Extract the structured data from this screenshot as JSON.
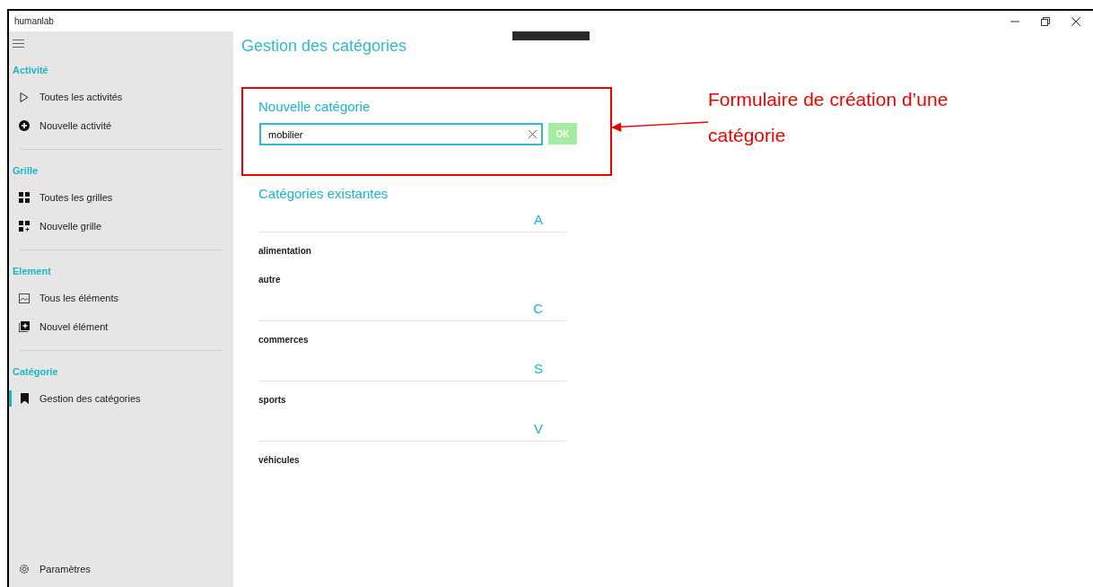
{
  "window": {
    "title": "humanlab"
  },
  "sidebar": {
    "sections": [
      {
        "title": "Activité",
        "items": [
          {
            "label": "Toutes les activités",
            "kind": "list",
            "selected": false
          },
          {
            "label": "Nouvelle activité",
            "kind": "create",
            "selected": false
          }
        ]
      },
      {
        "title": "Grille",
        "items": [
          {
            "label": "Toutes les grilles",
            "kind": "list",
            "selected": false
          },
          {
            "label": "Nouvelle grille",
            "kind": "create",
            "selected": false
          }
        ]
      },
      {
        "title": "Element",
        "items": [
          {
            "label": "Tous les éléments",
            "kind": "list",
            "selected": false
          },
          {
            "label": "Nouvel élément",
            "kind": "create",
            "selected": false
          }
        ]
      },
      {
        "title": "Catégorie",
        "items": [
          {
            "label": "Gestion des catégories",
            "kind": "manage",
            "selected": true
          }
        ]
      }
    ],
    "footer": {
      "label": "Paramètres"
    }
  },
  "page": {
    "title": "Gestion des catégories",
    "new_category": {
      "heading": "Nouvelle catégorie",
      "value": "mobilier",
      "button": "OK",
      "button_disabled": true
    },
    "existing": {
      "heading": "Catégories existantes",
      "groups": [
        {
          "letter": "A",
          "items": [
            "alimentation",
            "autre"
          ]
        },
        {
          "letter": "C",
          "items": [
            "commerces"
          ]
        },
        {
          "letter": "S",
          "items": [
            "sports"
          ]
        },
        {
          "letter": "V",
          "items": [
            "véhicules"
          ]
        }
      ]
    }
  },
  "annotation": {
    "text": "Formulaire de création d’une catégorie"
  }
}
